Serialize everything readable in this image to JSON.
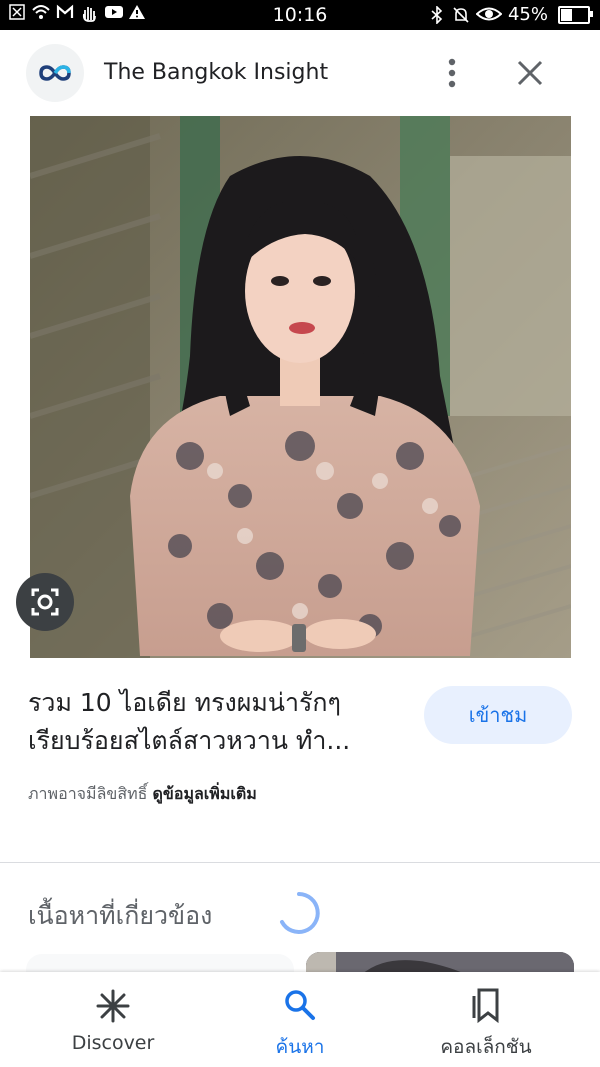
{
  "status_bar": {
    "time": "10:16",
    "battery": "45%",
    "battery_level": 0.45,
    "left_icons": [
      "close-box-icon",
      "wifi-icon",
      "gmail-icon",
      "hand-icon",
      "youtube-icon",
      "warning-icon"
    ],
    "right_icons": [
      "bluetooth-icon",
      "alarm-off-icon",
      "eye-icon",
      "battery-icon"
    ]
  },
  "header": {
    "site_name": "The Bangkok Insight",
    "more_icon": "more-vert-icon",
    "close_icon": "close-icon",
    "close_glyph": "✕"
  },
  "result": {
    "title": "รวม 10 ไอเดีย ทรงผมน่ารักๆ เรียบร้อยสไตล์สาวหวาน ทำ...",
    "visit_label": "เข้าชม",
    "copyright_text": "ภาพอาจมีลิขสิทธิ์",
    "more_info_link": "ดูข้อมูลเพิ่มเติม",
    "lens_icon": "lens-icon"
  },
  "related": {
    "heading": "เนื้อหาที่เกี่ยวข้อง"
  },
  "bottom_nav": {
    "items": [
      {
        "label": "Discover",
        "icon": "asterisk-icon",
        "active": false
      },
      {
        "label": "ค้นหา",
        "icon": "search-icon",
        "active": true
      },
      {
        "label": "คอลเล็กชัน",
        "icon": "collections-icon",
        "active": false
      }
    ]
  },
  "colors": {
    "accent": "#1a73e8",
    "visit_bg": "#e8f0fe",
    "text": "#202124",
    "secondary": "#5f6368"
  }
}
